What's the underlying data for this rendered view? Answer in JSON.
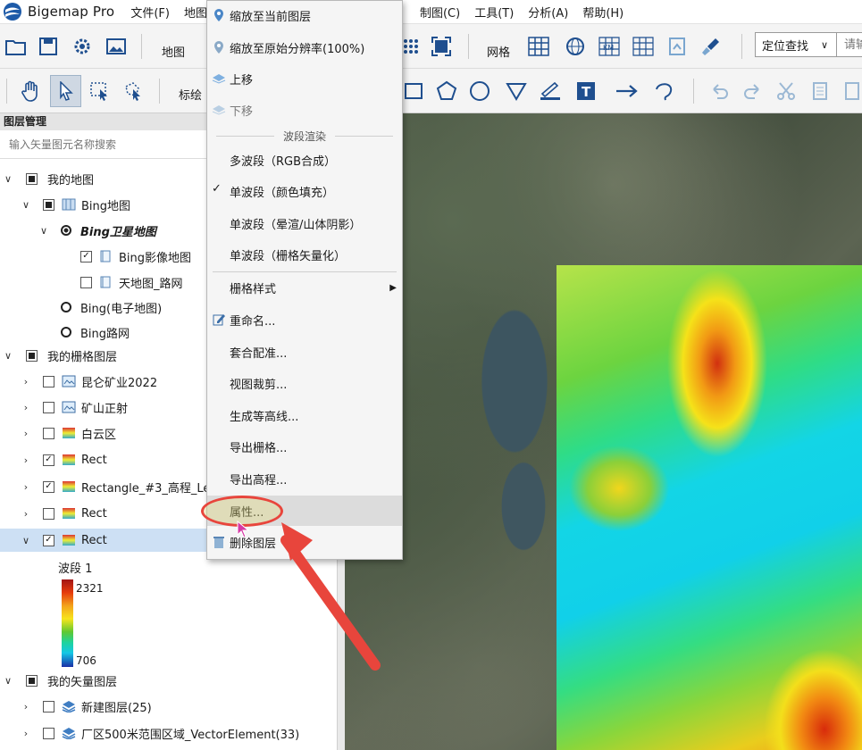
{
  "app": {
    "title": "Bigemap Pro"
  },
  "menubar": {
    "items": [
      "文件(F)",
      "地图",
      "制图(C)",
      "工具(T)",
      "分析(A)",
      "帮助(H)"
    ]
  },
  "toolbar1": {
    "map_label": "地图",
    "grid_label": "网格",
    "locate_label": "定位查找",
    "coord_placeholder": "请输"
  },
  "toolbar2": {
    "draw_label": "标绘"
  },
  "layer_panel": {
    "title": "图层管理",
    "search_placeholder": "输入矢量图元名称搜索",
    "rows": [
      "我的地图",
      "Bing地图",
      "Bing卫星地图",
      "Bing影像地图",
      "天地图_路网",
      "Bing(电子地图)",
      "Bing路网",
      "我的栅格图层",
      "昆仑矿业2022",
      "矿山正射",
      "白云区",
      "Rect",
      "Rectangle_#3_高程_Le",
      "Rect",
      "Rect",
      "我的矢量图层",
      "新建图层(25)",
      "厂区500米范围区域_VectorElement(33)"
    ],
    "legend": {
      "title": "波段 1",
      "max": "2321",
      "min": "706"
    }
  },
  "context_menu": {
    "zoom_to_layer": "缩放至当前图层",
    "zoom_native": "缩放至原始分辨率(100%)",
    "move_up": "上移",
    "move_down": "下移",
    "band_render_section": "波段渲染",
    "multiband": "多波段（RGB合成）",
    "single_color": "单波段（颜色填充）",
    "single_hillshade": "单波段（晕渲/山体阴影）",
    "single_vectorize": "单波段（栅格矢量化）",
    "raster_style": "栅格样式",
    "rename": "重命名...",
    "register": "套合配准...",
    "clip": "视图裁剪...",
    "contour": "生成等高线...",
    "export_raster": "导出栅格...",
    "export_elev": "导出高程...",
    "properties": "属性...",
    "delete": "删除图层"
  },
  "colors": {
    "accent": "#e8453c",
    "selected_row": "#cde0f4"
  }
}
